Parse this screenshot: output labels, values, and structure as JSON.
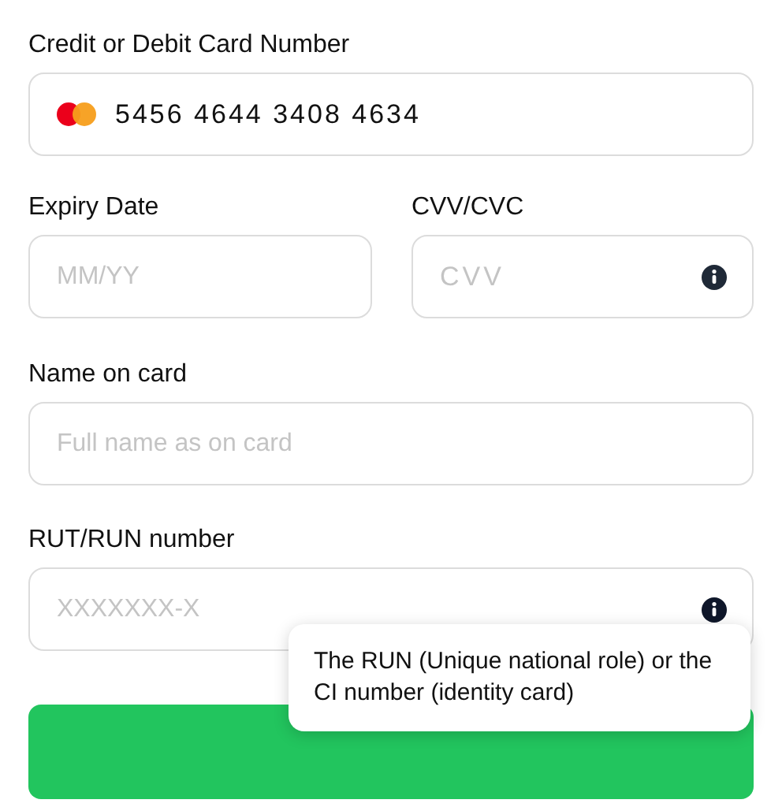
{
  "card_number": {
    "label": "Credit or Debit Card Number",
    "value": "5456 4644 3408 4634"
  },
  "expiry": {
    "label": "Expiry Date",
    "placeholder": "MM/YY"
  },
  "cvv": {
    "label": "CVV/CVC",
    "placeholder": "CVV"
  },
  "name": {
    "label": "Name on card",
    "placeholder": "Full name as on card"
  },
  "rut": {
    "label": "RUT/RUN number",
    "placeholder": "XXXXXXX-X"
  },
  "tooltip": {
    "text": "The RUN (Unique national role) or the CI number (identity card)"
  }
}
